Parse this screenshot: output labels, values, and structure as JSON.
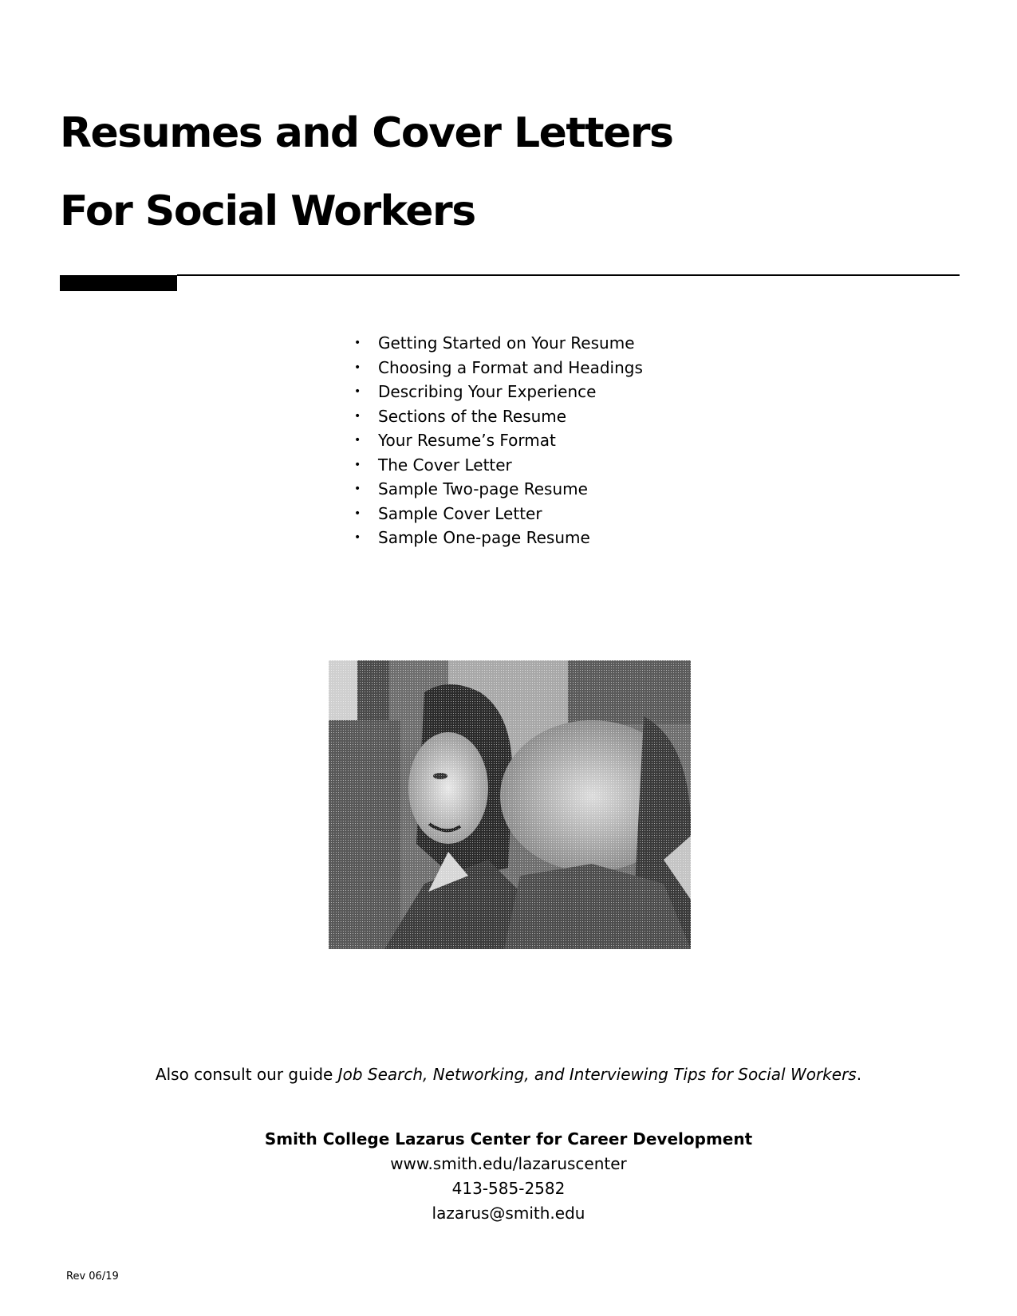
{
  "document": {
    "title_lines": [
      "Resumes and Cover Letters",
      "For Social Workers"
    ],
    "contents": [
      "Getting Started on Your Resume",
      "Choosing a Format and Headings",
      "Describing Your Experience",
      "Sections of the Resume",
      "Your Resume’s Format",
      "The Cover Letter",
      "Sample Two-page Resume",
      "Sample Cover Letter",
      "Sample One-page Resume"
    ],
    "bullet_glyph": "•",
    "photo_alt": "Black-and-white halftone photo of two smiling people",
    "guide_note": {
      "prefix": "Also consult our guide ",
      "title": "Job Search, Networking, and Interviewing Tips for Social Workers",
      "suffix": "."
    },
    "organization": {
      "name": "Smith College Lazarus Center for Career Development",
      "website": "www.smith.edu/lazaruscenter",
      "phone": "413-585-2582",
      "email": "lazarus@smith.edu"
    },
    "revision": "Rev 06/19"
  }
}
